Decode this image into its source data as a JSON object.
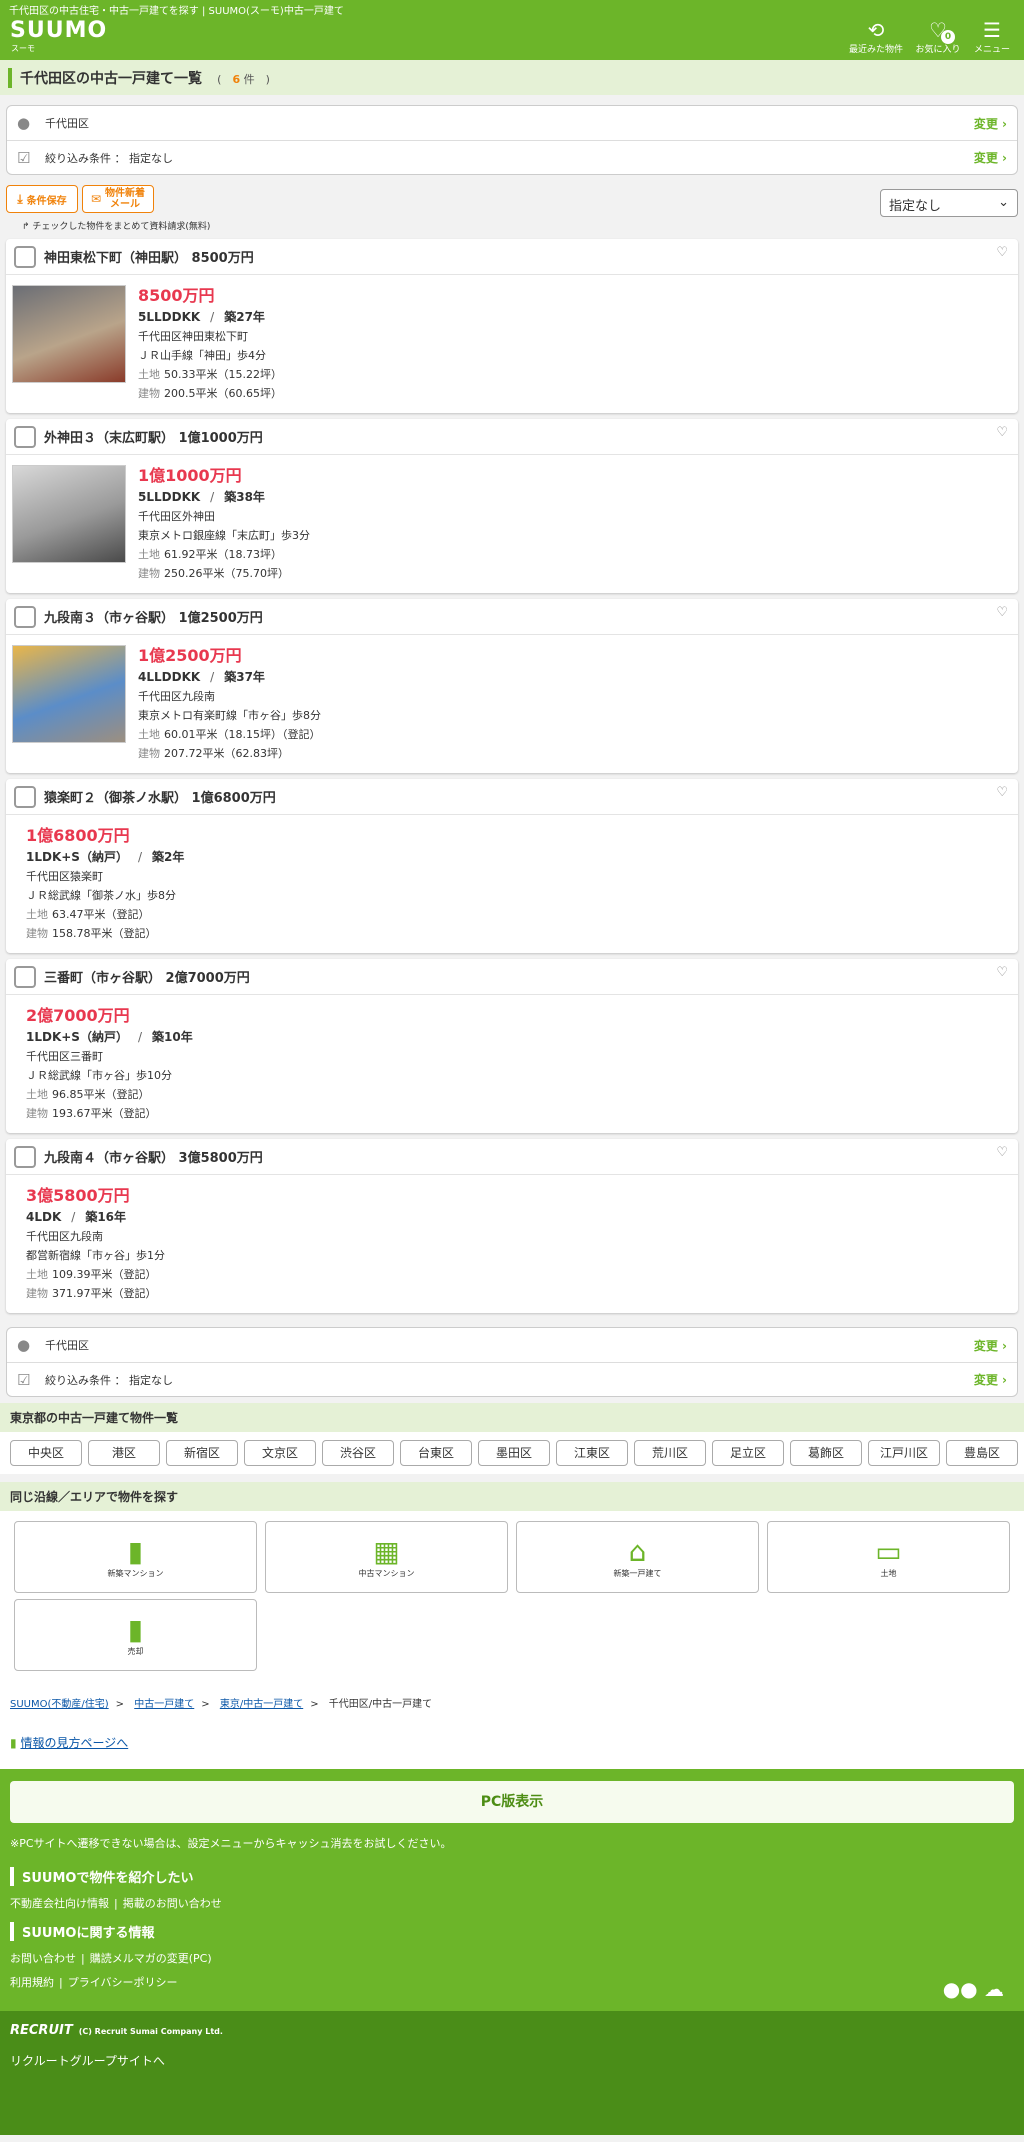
{
  "header": {
    "tagline": "千代田区の中古住宅・中古一戸建てを探す | SUUMO(スーモ)中古一戸建て",
    "logo": "SUUMO",
    "logo_sub": "スーモ",
    "recent": "最近みた物件",
    "fav": "お気に入り",
    "fav_count": "0",
    "menu": "メニュー"
  },
  "page": {
    "title": "千代田区の中古一戸建て一覧",
    "count_open": "(",
    "count": "6",
    "count_unit": "件",
    "count_close": ")"
  },
  "cond": {
    "area": "千代田区",
    "filter": "絞り込み条件 ： 指定なし",
    "change": "変更"
  },
  "tools": {
    "save": "条件保存",
    "notify": "物件新着メール",
    "sort": "指定なし",
    "bulk": "チェックした物件をまとめて資料請求(無料)"
  },
  "listings": [
    {
      "title": "神田東松下町（神田駅） 8500万円",
      "price": "8500万円",
      "layout": "5LLDDKK",
      "age": "築27年",
      "address": "千代田区神田東松下町",
      "station": "ＪＲ山手線「神田」歩4分",
      "land_label": "土地",
      "land": "50.33平米（15.22坪）",
      "bldg_label": "建物",
      "bldg": "200.5平米（60.65坪）",
      "has_photo": true
    },
    {
      "title": "外神田３（末広町駅） 1億1000万円",
      "price": "1億1000万円",
      "layout": "5LLDDKK",
      "age": "築38年",
      "address": "千代田区外神田",
      "station": "東京メトロ銀座線「末広町」歩3分",
      "land_label": "土地",
      "land": "61.92平米（18.73坪）",
      "bldg_label": "建物",
      "bldg": "250.26平米（75.70坪）",
      "has_photo": true
    },
    {
      "title": "九段南３（市ヶ谷駅） 1億2500万円",
      "price": "1億2500万円",
      "layout": "4LLDDKK",
      "age": "築37年",
      "address": "千代田区九段南",
      "station": "東京メトロ有楽町線「市ヶ谷」歩8分",
      "land_label": "土地",
      "land": "60.01平米（18.15坪）（登記）",
      "bldg_label": "建物",
      "bldg": "207.72平米（62.83坪）",
      "has_photo": true
    },
    {
      "title": "猿楽町２（御茶ノ水駅） 1億6800万円",
      "price": "1億6800万円",
      "layout": "1LDK+S（納戸）",
      "age": "築2年",
      "address": "千代田区猿楽町",
      "station": "ＪＲ総武線「御茶ノ水」歩8分",
      "land_label": "土地",
      "land": "63.47平米（登記）",
      "bldg_label": "建物",
      "bldg": "158.78平米（登記）",
      "has_photo": false
    },
    {
      "title": "三番町（市ヶ谷駅） 2億7000万円",
      "price": "2億7000万円",
      "layout": "1LDK+S（納戸）",
      "age": "築10年",
      "address": "千代田区三番町",
      "station": "ＪＲ総武線「市ヶ谷」歩10分",
      "land_label": "土地",
      "land": "96.85平米（登記）",
      "bldg_label": "建物",
      "bldg": "193.67平米（登記）",
      "has_photo": false
    },
    {
      "title": "九段南４（市ヶ谷駅） 3億5800万円",
      "price": "3億5800万円",
      "layout": "4LDK",
      "age": "築16年",
      "address": "千代田区九段南",
      "station": "都営新宿線「市ヶ谷」歩1分",
      "land_label": "土地",
      "land": "109.39平米（登記）",
      "bldg_label": "建物",
      "bldg": "371.97平米（登記）",
      "has_photo": false
    }
  ],
  "city_heading": "東京都の中古一戸建て物件一覧",
  "wards": [
    "中央区",
    "港区",
    "新宿区",
    "文京区",
    "渋谷区",
    "台東区",
    "墨田区",
    "江東区",
    "荒川区",
    "足立区",
    "葛飾区",
    "江戸川区",
    "豊島区"
  ],
  "same_heading": "同じ沿線／エリアで物件を探す",
  "categories": [
    "新築マンション",
    "中古マンション",
    "新築一戸建て",
    "土地",
    "売却"
  ],
  "breadcrumb": [
    "SUUMO(不動産/住宅)",
    "中古一戸建て",
    "東京/中古一戸建て",
    "千代田区/中古一戸建て"
  ],
  "howto": "情報の見方ページへ",
  "footer": {
    "pc": "PC版表示",
    "note": "※PCサイトへ遷移できない場合は、設定メニューからキャッシュ消去をお試しください。",
    "h1": "SUUMOで物件を紹介したい",
    "l1a": "不動産会社向け情報",
    "l1b": "掲載のお問い合わせ",
    "h2": "SUUMOに関する情報",
    "l2a": "お問い合わせ",
    "l2b": "購読メルマガの変更(PC)",
    "l3a": "利用規約",
    "l3b": "プライバシーポリシー",
    "recruit": "RECRUIT",
    "copyright": "(C) Recruit Sumai Company Ltd.",
    "group": "リクルートグループサイトへ"
  }
}
